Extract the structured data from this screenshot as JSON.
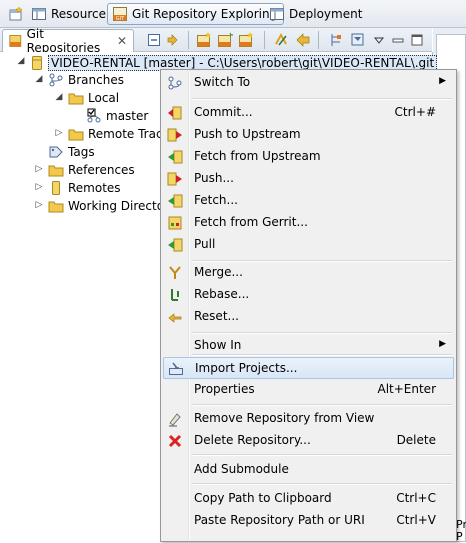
{
  "perspectives": {
    "resource": "Resource",
    "git": "Git Repository Exploring",
    "deployment": "Deployment"
  },
  "view": {
    "tab_title": "Git Repositories"
  },
  "tree": {
    "repo": "VIDEO-RENTAL [master] - C:\\Users\\robert\\git\\VIDEO-RENTAL\\.git",
    "branches": "Branches",
    "local": "Local",
    "master": "master",
    "remote_tracking": "Remote Track",
    "tags": "Tags",
    "references": "References",
    "remotes": "Remotes",
    "working_directory": "Working Director"
  },
  "right_strip": {
    "label_top": "Pr",
    "label_bottom": "P"
  },
  "menu": {
    "switch_to": "Switch To",
    "commit": "Commit...",
    "commit_acc": "Ctrl+#",
    "push_upstream": "Push to Upstream",
    "fetch_upstream": "Fetch from Upstream",
    "push": "Push...",
    "fetch": "Fetch...",
    "fetch_gerrit": "Fetch from Gerrit...",
    "pull": "Pull",
    "merge": "Merge...",
    "rebase": "Rebase...",
    "reset": "Reset...",
    "show_in": "Show In",
    "import_projects": "Import Projects...",
    "properties": "Properties",
    "properties_acc": "Alt+Enter",
    "remove_repo": "Remove Repository from View",
    "delete_repo": "Delete Repository...",
    "delete_acc": "Delete",
    "add_submodule": "Add Submodule",
    "copy_path": "Copy Path to Clipboard",
    "copy_acc": "Ctrl+C",
    "paste_path": "Paste Repository Path or URI",
    "paste_acc": "Ctrl+V"
  }
}
